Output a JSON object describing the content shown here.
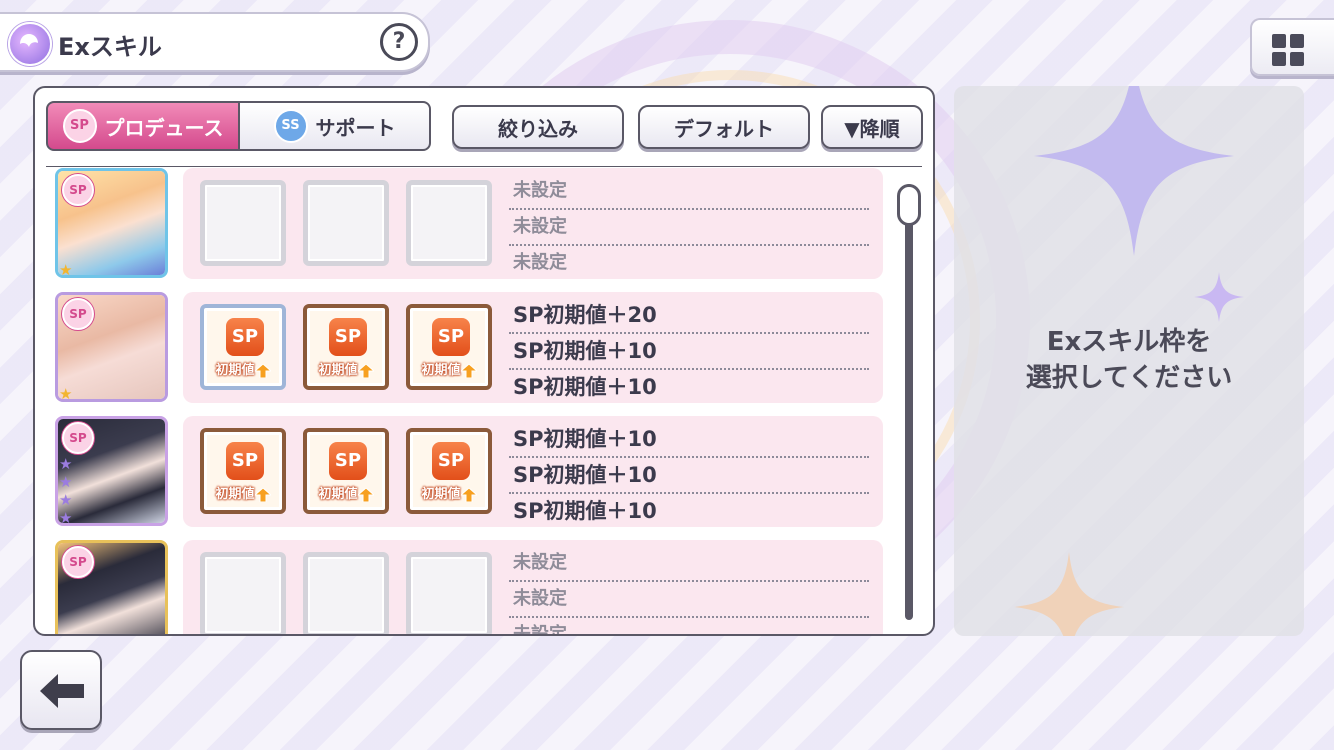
{
  "header": {
    "title": "Exスキル",
    "help_label": "?"
  },
  "tabs": {
    "produce": {
      "label": "プロデュース",
      "badge": "SP"
    },
    "support": {
      "label": "サポート",
      "badge": "SS"
    }
  },
  "controls": {
    "filter_label": "絞り込み",
    "sort_label": "デフォルト",
    "order_label": "▼降順"
  },
  "rows": [
    {
      "badge": "SP",
      "stars": 1,
      "slots": [
        "empty",
        "empty",
        "empty"
      ],
      "skills": [
        "未設定",
        "未設定",
        "未設定"
      ]
    },
    {
      "badge": "SP",
      "stars": 1,
      "slots": [
        "sp",
        "sp",
        "sp"
      ],
      "skills": [
        "SP初期値＋20",
        "SP初期値＋10",
        "SP初期値＋10"
      ]
    },
    {
      "badge": "SP",
      "stars": 4,
      "slots": [
        "sp",
        "sp",
        "sp"
      ],
      "skills": [
        "SP初期値＋10",
        "SP初期値＋10",
        "SP初期値＋10"
      ]
    },
    {
      "badge": "SP",
      "stars": 0,
      "slots": [
        "empty",
        "empty",
        "empty"
      ],
      "skills": [
        "未設定",
        "未設定",
        "未設定"
      ]
    }
  ],
  "slot_item": {
    "icon_text": "SP",
    "label": "初期値"
  },
  "side_panel": {
    "line1": "Exスキル枠を",
    "line2": "選択してください"
  },
  "icons": {
    "menu": "grid-icon",
    "back": "arrow-left-icon",
    "header": "skill-icon"
  },
  "colors": {
    "accent_pink": "#d44a8d",
    "skill_orange": "#e24f1a",
    "border": "#5a5866"
  }
}
